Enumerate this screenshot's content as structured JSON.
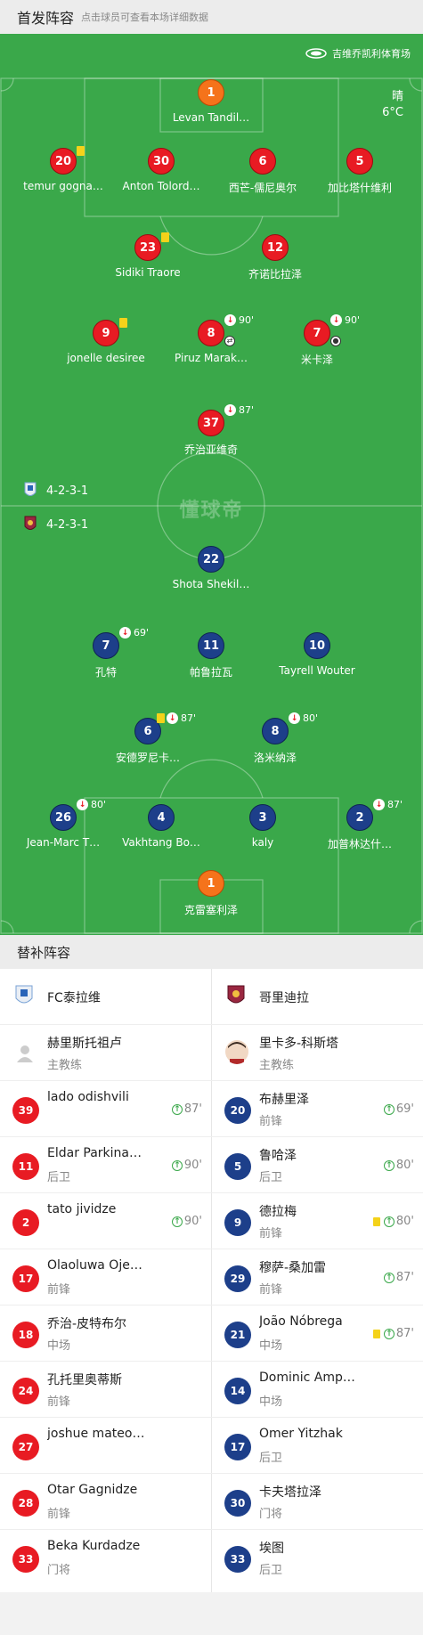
{
  "header": {
    "title": "首发阵容",
    "hint": "点击球员可查看本场详细数据"
  },
  "venue": {
    "name": "吉维乔凯利体育场",
    "weather": "晴",
    "temperature": "6°C"
  },
  "watermark": "懂球帝",
  "home_formation": "4-2-3-1",
  "away_formation": "4-2-3-1",
  "home_players": [
    {
      "num": "1",
      "name": "Levan Tandil…",
      "gk": true
    },
    {
      "num": "20",
      "name": "temur gogna…",
      "yellow": true
    },
    {
      "num": "30",
      "name": "Anton Tolord…"
    },
    {
      "num": "6",
      "name": "西芒-儒尼奥尔"
    },
    {
      "num": "5",
      "name": "加比塔什维利"
    },
    {
      "num": "23",
      "name": "Sidiki Traore",
      "yellow": true
    },
    {
      "num": "12",
      "name": "齐诺比拉泽"
    },
    {
      "num": "9",
      "name": "jonelle desiree",
      "yellow": true
    },
    {
      "num": "8",
      "name": "Piruz Marak…",
      "sub_min": "90'"
    },
    {
      "num": "7",
      "name": "米卡泽",
      "sub_min": "90'",
      "goal": true
    },
    {
      "num": "37",
      "name": "乔治亚维奇",
      "sub_min": "87'"
    }
  ],
  "away_players": [
    {
      "num": "22",
      "name": "Shota Shekil…"
    },
    {
      "num": "7",
      "name": "孔特",
      "sub_min": "69'"
    },
    {
      "num": "11",
      "name": "帕鲁拉瓦"
    },
    {
      "num": "10",
      "name": "Tayrell Wouter"
    },
    {
      "num": "6",
      "name": "安德罗尼卡…",
      "sub_min": "87'",
      "yellow": true
    },
    {
      "num": "8",
      "name": "洛米纳泽",
      "sub_min": "80'"
    },
    {
      "num": "26",
      "name": "Jean-Marc T…",
      "sub_min": "80'"
    },
    {
      "num": "4",
      "name": "Vakhtang Bo…"
    },
    {
      "num": "3",
      "name": "kaly"
    },
    {
      "num": "2",
      "name": "加普林达什…",
      "sub_min": "87'"
    },
    {
      "num": "1",
      "name": "克雷塞利泽",
      "gk": true
    }
  ],
  "bench": {
    "title": "替补阵容",
    "home_team": "FC泰拉维",
    "away_team": "哥里迪拉",
    "home_coach": {
      "name": "赫里斯托祖卢",
      "role": "主教练"
    },
    "away_coach": {
      "name": "里卡多-科斯塔",
      "role": "主教练"
    },
    "home": [
      {
        "num": "39",
        "name": "lado odishvili",
        "pos": "",
        "sub": "87'"
      },
      {
        "num": "11",
        "name": "Eldar Parkina…",
        "pos": "后卫",
        "sub": "90'"
      },
      {
        "num": "2",
        "name": "tato jividze",
        "pos": "",
        "sub": "90'"
      },
      {
        "num": "17",
        "name": "Olaoluwa Oje…",
        "pos": "前锋",
        "sub": ""
      },
      {
        "num": "18",
        "name": "乔治-皮特布尔",
        "pos": "中场",
        "sub": ""
      },
      {
        "num": "24",
        "name": "孔托里奥蒂斯",
        "pos": "前锋",
        "sub": ""
      },
      {
        "num": "27",
        "name": "joshue mateo…",
        "pos": "",
        "sub": ""
      },
      {
        "num": "28",
        "name": "Otar Gagnidze",
        "pos": "前锋",
        "sub": ""
      },
      {
        "num": "33",
        "name": "Beka Kurdadze",
        "pos": "门将",
        "sub": ""
      }
    ],
    "away": [
      {
        "num": "20",
        "name": "布赫里泽",
        "pos": "前锋",
        "sub": "69'",
        "yellow": false
      },
      {
        "num": "5",
        "name": "鲁哈泽",
        "pos": "后卫",
        "sub": "80'",
        "yellow": false
      },
      {
        "num": "9",
        "name": "德拉梅",
        "pos": "前锋",
        "sub": "80'",
        "yellow": true
      },
      {
        "num": "29",
        "name": "穆萨-桑加雷",
        "pos": "前锋",
        "sub": "87'",
        "yellow": false
      },
      {
        "num": "21",
        "name": "João Nóbrega",
        "pos": "中场",
        "sub": "87'",
        "yellow": true
      },
      {
        "num": "14",
        "name": "Dominic Amp…",
        "pos": "中场",
        "sub": "",
        "yellow": false
      },
      {
        "num": "17",
        "name": "Omer Yitzhak",
        "pos": "后卫",
        "sub": "",
        "yellow": false
      },
      {
        "num": "30",
        "name": "卡夫塔拉泽",
        "pos": "门将",
        "sub": "",
        "yellow": false
      },
      {
        "num": "33",
        "name": "埃图",
        "pos": "后卫",
        "sub": "",
        "yellow": false
      }
    ]
  },
  "colors": {
    "pitch": "#3aa84a",
    "home": "#e81b23",
    "away": "#1d3f8a",
    "gk": "#f5731b",
    "yellow_card": "#f4d21a"
  }
}
